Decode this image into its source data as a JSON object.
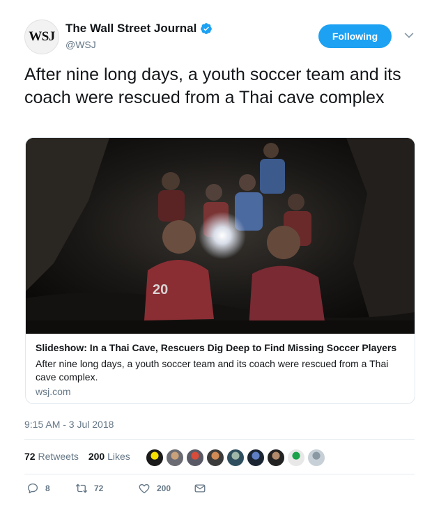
{
  "account": {
    "avatar_text": "WSJ",
    "display_name": "The Wall Street Journal",
    "handle": "@WSJ",
    "verified_icon": "verified-badge-icon"
  },
  "follow_button": {
    "label": "Following"
  },
  "menu_icon": "chevron-down-icon",
  "tweet": {
    "text": "After nine long days, a youth soccer team and its coach were rescued from a Thai cave complex",
    "timestamp": "9:15 AM - 3 Jul 2018"
  },
  "card": {
    "image": "cave-photo",
    "title": "Slideshow: In a Thai Cave, Rescuers Dig Deep to Find Missing Soccer Players",
    "description": "After nine long days, a youth soccer team and its coach were rescued from a Thai cave complex.",
    "domain": "wsj.com"
  },
  "stats": {
    "retweets_count": "72",
    "retweets_label": "Retweets",
    "likes_count": "200",
    "likes_label": "Likes"
  },
  "likers": [
    {
      "name": "liker-avatar-1",
      "color": "#1a1a1a",
      "accent": "#f5e000"
    },
    {
      "name": "liker-avatar-2",
      "color": "#6b6b73",
      "accent": "#c9a17a"
    },
    {
      "name": "liker-avatar-3",
      "color": "#5a5a66",
      "accent": "#d94b3a"
    },
    {
      "name": "liker-avatar-4",
      "color": "#3b3b3b",
      "accent": "#d08a55"
    },
    {
      "name": "liker-avatar-5",
      "color": "#2f4f5f",
      "accent": "#9fb7a8"
    },
    {
      "name": "liker-avatar-6",
      "color": "#1c2633",
      "accent": "#5f7fc5"
    },
    {
      "name": "liker-avatar-7",
      "color": "#222222",
      "accent": "#b08a6a"
    },
    {
      "name": "liker-avatar-8",
      "color": "#e8e8e8",
      "accent": "#1aa34a"
    },
    {
      "name": "liker-avatar-9",
      "color": "#c7d0d6",
      "accent": "#8a98a3"
    }
  ],
  "actions": {
    "reply_count": "8",
    "retweet_count": "72",
    "like_count": "200"
  },
  "colors": {
    "accent": "#1da1f2",
    "text": "#14171a",
    "secondary": "#657786",
    "border": "#e1e8ed"
  }
}
